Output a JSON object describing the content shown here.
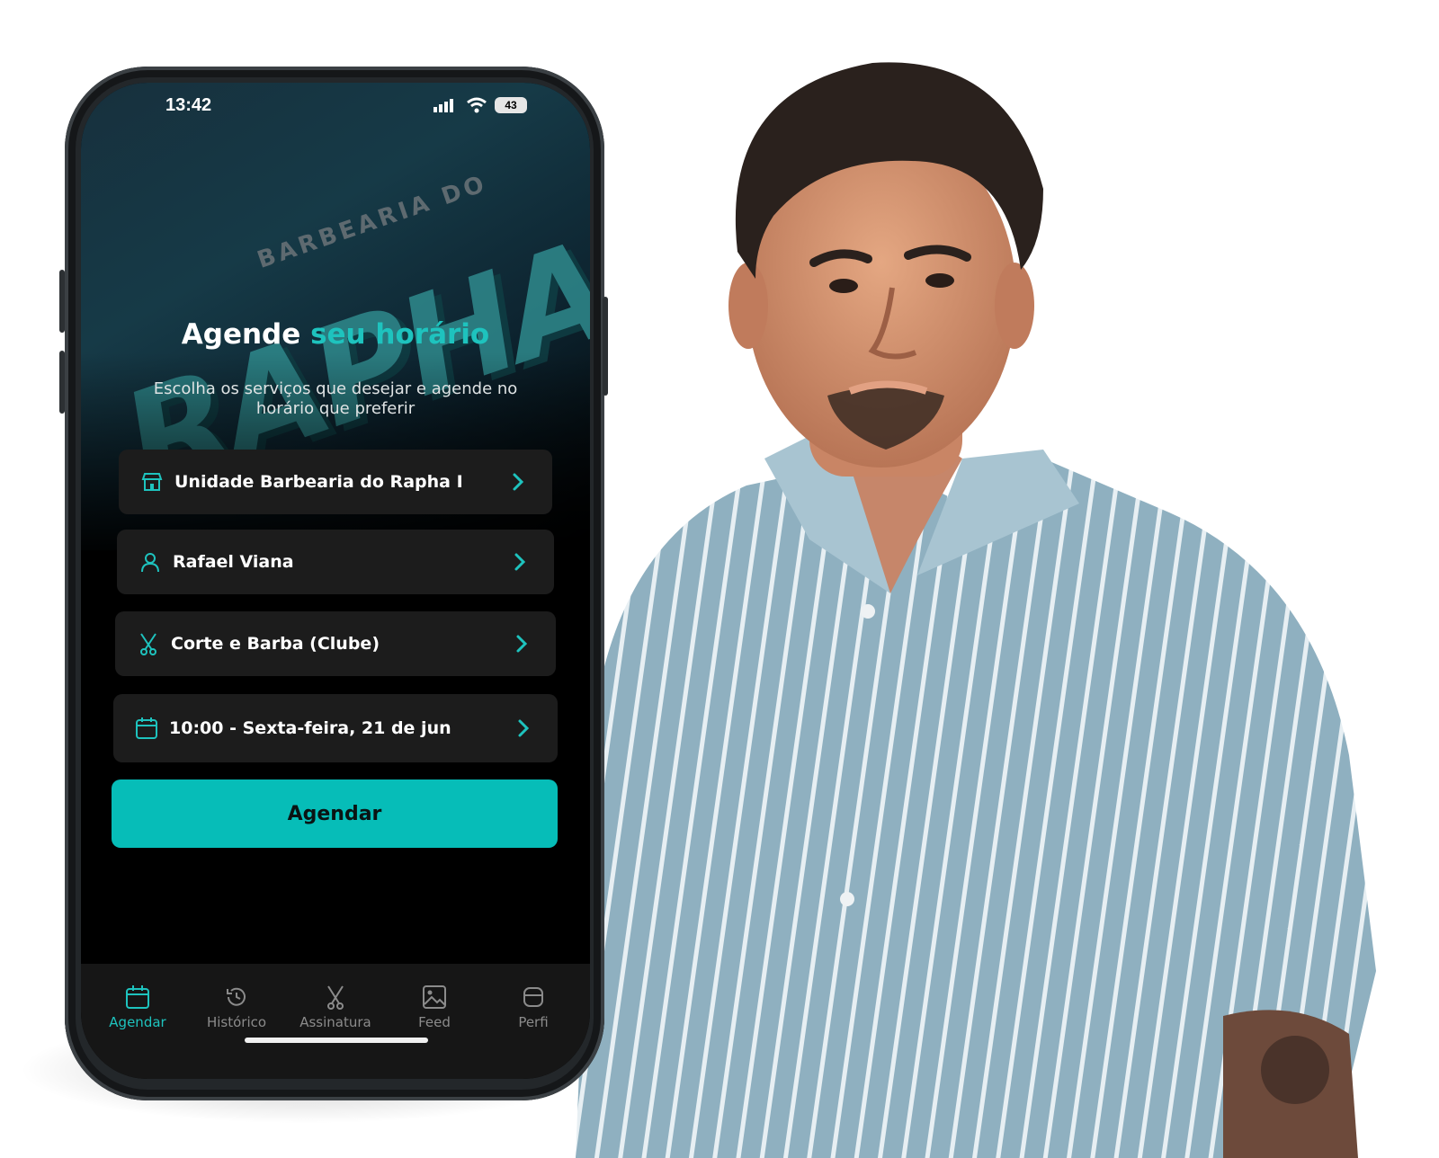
{
  "status_bar": {
    "time": "13:42",
    "battery": "43"
  },
  "hero": {
    "brand_small": "BARBEARIA DO",
    "brand_big": "RAPHA",
    "headline_part1": "Agende",
    "headline_part2": "seu horário",
    "subtitle": "Escolha os serviços que desejar e agende no horário que preferir"
  },
  "selections": [
    {
      "icon": "store-icon",
      "label": "Unidade Barbearia do Rapha I"
    },
    {
      "icon": "user-icon",
      "label": "Rafael Viana"
    },
    {
      "icon": "scissors-icon",
      "label": "Corte e Barba (Clube)"
    },
    {
      "icon": "calendar-icon",
      "label": "10:00 - Sexta-feira, 21 de jun"
    }
  ],
  "cta": {
    "label": "Agendar"
  },
  "tabbar": {
    "active": "Agendar",
    "tabs": [
      {
        "label": "Agendar",
        "icon": "calendar-icon"
      },
      {
        "label": "Histórico",
        "icon": "history-icon"
      },
      {
        "label": "Assinatura",
        "icon": "scissors-icon"
      },
      {
        "label": "Feed",
        "icon": "image-icon"
      },
      {
        "label": "Perfi",
        "icon": "profile-icon"
      }
    ]
  },
  "colors": {
    "accent": "#06bdb8",
    "card": "#1c1c1c",
    "shirt": "#8fb0c0"
  }
}
